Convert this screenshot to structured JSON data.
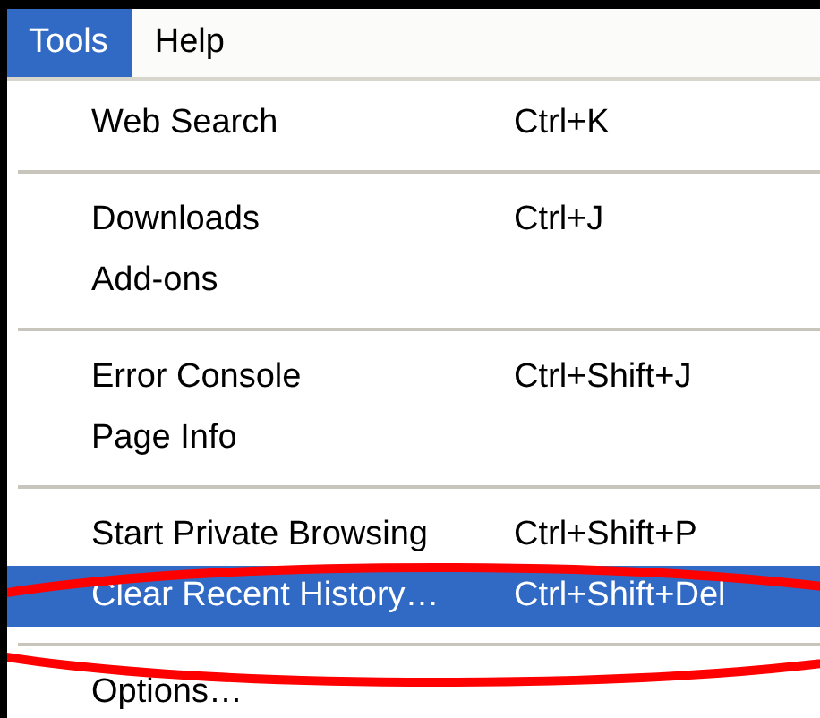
{
  "menu_bar": [
    {
      "label": "Tools",
      "selected": true
    },
    {
      "label": "Help",
      "selected": false
    }
  ],
  "menu": [
    {
      "kind": "item",
      "label": "Web Search",
      "shortcut": "Ctrl+K",
      "selected": false
    },
    {
      "kind": "separator"
    },
    {
      "kind": "item",
      "label": "Downloads",
      "shortcut": "Ctrl+J",
      "selected": false
    },
    {
      "kind": "item",
      "label": "Add-ons",
      "selected": false
    },
    {
      "kind": "separator"
    },
    {
      "kind": "item",
      "label": "Error Console",
      "shortcut": "Ctrl+Shift+J",
      "selected": false
    },
    {
      "kind": "item",
      "label": "Page Info",
      "selected": false
    },
    {
      "kind": "separator"
    },
    {
      "kind": "item",
      "label": "Start Private Browsing",
      "shortcut": "Ctrl+Shift+P",
      "selected": false
    },
    {
      "kind": "item",
      "label": "Clear Recent History…",
      "shortcut": "Ctrl+Shift+Del",
      "selected": true
    },
    {
      "kind": "separator"
    },
    {
      "kind": "item",
      "label": "Options…",
      "selected": false
    }
  ],
  "annotation": {
    "kind": "ellipse"
  }
}
